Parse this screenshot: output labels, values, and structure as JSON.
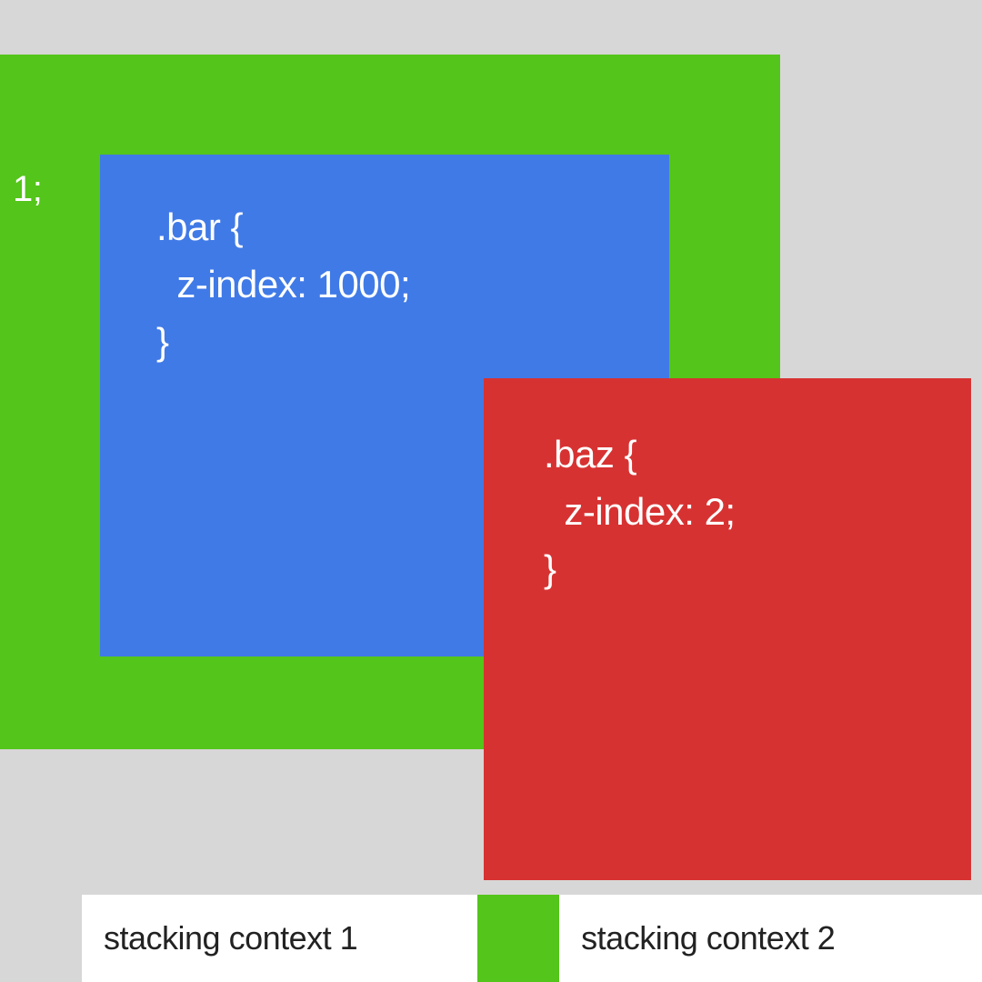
{
  "boxes": {
    "green": {
      "label": "1;",
      "color": "#54c51a"
    },
    "blue": {
      "code": ".bar {\n  z-index: 1000;\n}",
      "color": "#407ae7"
    },
    "red": {
      "code": ".baz {\n  z-index: 2;\n}",
      "color": "#d73232"
    }
  },
  "legend": {
    "items": [
      {
        "swatch_color": "#d8d7d7",
        "label": "stacking context 1"
      },
      {
        "swatch_color": "#54c51a",
        "label": "stacking context 2"
      }
    ]
  }
}
